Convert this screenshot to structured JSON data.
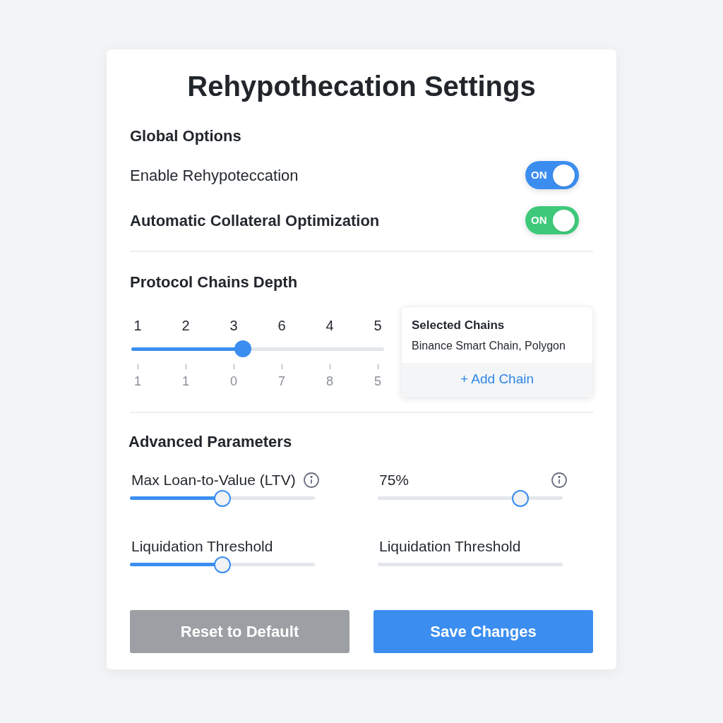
{
  "title": "Rehypothecation Settings",
  "global_options": {
    "heading": "Global Options",
    "toggles": [
      {
        "label": "Enable Rehypoteccation",
        "on": true,
        "color": "#3b8ef0",
        "state_text": "ON",
        "bold": false
      },
      {
        "label": "Automatic Collateral Optimization",
        "on": true,
        "color": "#3ec97a",
        "state_text": "ON",
        "bold": true
      }
    ]
  },
  "protocol_chains": {
    "heading": "Protocol Chains Depth",
    "scale_labels": [
      "1",
      "2",
      "3",
      "6",
      "4",
      "5"
    ],
    "tick_labels": [
      "1",
      "1",
      "0",
      "7",
      "8",
      "5"
    ],
    "level": 0.44,
    "selected_chains": {
      "title": "Selected Chains",
      "value": "Binance Smart Chain, Polygon",
      "add_button": "+ Add Chain"
    }
  },
  "advanced": {
    "heading": "Advanced Parameters",
    "sliders": [
      {
        "label": "Max Loan-to-Value (LTV)",
        "info": true,
        "kind": "filled",
        "level": 0.5
      },
      {
        "label": "75%",
        "info": true,
        "kind": "thumb",
        "level": 0.77
      },
      {
        "label": "Liquidation Threshold",
        "info": false,
        "kind": "filled",
        "level": 0.5
      },
      {
        "label": "Liquidation Threshold",
        "info": false,
        "kind": "track"
      }
    ]
  },
  "buttons": [
    {
      "label": "Reset to Default",
      "kind": "secondary"
    },
    {
      "label": "Save Changes",
      "kind": "primary"
    }
  ]
}
